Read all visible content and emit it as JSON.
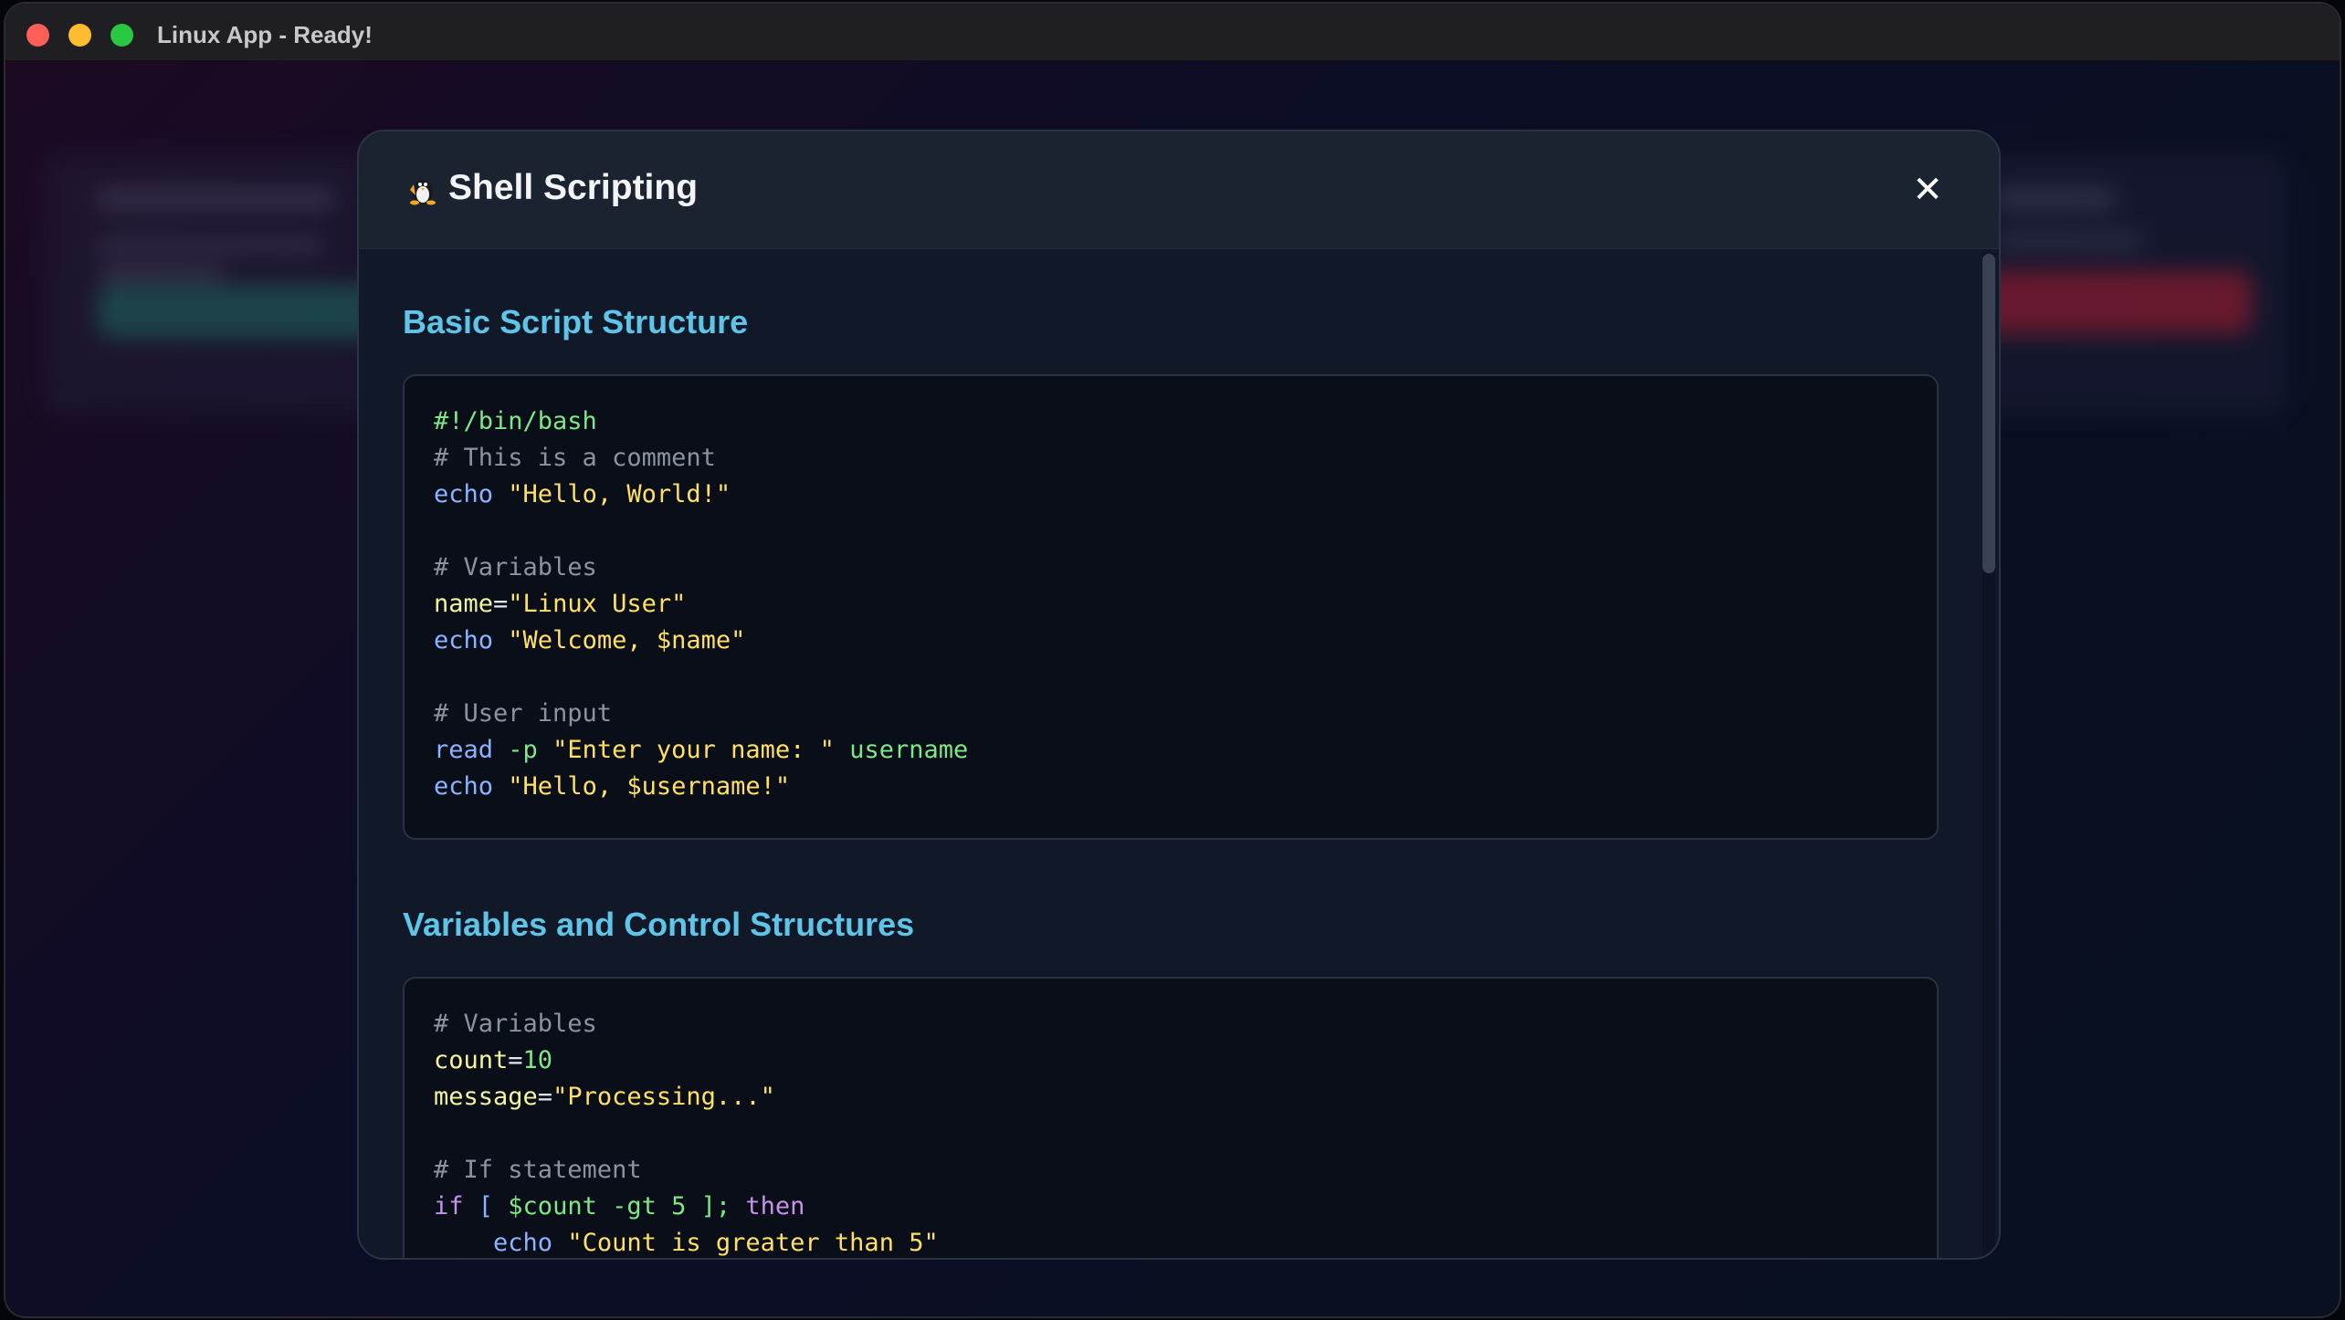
{
  "window": {
    "title": "Linux App - Ready!"
  },
  "modal": {
    "icon": "penguin-icon",
    "title": "Shell Scripting",
    "close_label": "✕"
  },
  "sections": [
    {
      "title": "Basic Script Structure",
      "code": [
        [
          {
            "t": "#!/bin/bash",
            "c": "shebang"
          }
        ],
        [
          {
            "t": "# This is a comment",
            "c": "comment"
          }
        ],
        [
          {
            "t": "echo",
            "c": "kw"
          },
          {
            "t": " ",
            "c": ""
          },
          {
            "t": "\"Hello, World!\"",
            "c": "str"
          }
        ],
        [],
        [
          {
            "t": "# Variables",
            "c": "comment"
          }
        ],
        [
          {
            "t": "name",
            "c": "var"
          },
          {
            "t": "=",
            "c": ""
          },
          {
            "t": "\"Linux User\"",
            "c": "str"
          }
        ],
        [
          {
            "t": "echo",
            "c": "kw"
          },
          {
            "t": " ",
            "c": ""
          },
          {
            "t": "\"Welcome, $name\"",
            "c": "str"
          }
        ],
        [],
        [
          {
            "t": "# User input",
            "c": "comment"
          }
        ],
        [
          {
            "t": "read",
            "c": "kw"
          },
          {
            "t": " ",
            "c": ""
          },
          {
            "t": "-p",
            "c": "green"
          },
          {
            "t": " ",
            "c": ""
          },
          {
            "t": "\"Enter your name: \"",
            "c": "str"
          },
          {
            "t": " ",
            "c": ""
          },
          {
            "t": "username",
            "c": "green"
          }
        ],
        [
          {
            "t": "echo",
            "c": "kw"
          },
          {
            "t": " ",
            "c": ""
          },
          {
            "t": "\"Hello, $username!\"",
            "c": "str"
          }
        ]
      ]
    },
    {
      "title": "Variables and Control Structures",
      "code": [
        [
          {
            "t": "# Variables",
            "c": "comment"
          }
        ],
        [
          {
            "t": "count",
            "c": "var"
          },
          {
            "t": "=",
            "c": ""
          },
          {
            "t": "10",
            "c": "green"
          }
        ],
        [
          {
            "t": "message",
            "c": "var"
          },
          {
            "t": "=",
            "c": ""
          },
          {
            "t": "\"Processing...\"",
            "c": "str"
          }
        ],
        [],
        [
          {
            "t": "# If statement",
            "c": "comment"
          }
        ],
        [
          {
            "t": "if",
            "c": "purple"
          },
          {
            "t": " [ ",
            "c": "kw"
          },
          {
            "t": "$count",
            "c": "green"
          },
          {
            "t": " -gt 5 ]; ",
            "c": "green"
          },
          {
            "t": "then",
            "c": "purple"
          }
        ],
        [
          {
            "t": "    ",
            "c": ""
          },
          {
            "t": "echo",
            "c": "kw"
          },
          {
            "t": " ",
            "c": ""
          },
          {
            "t": "\"Count is greater than 5\"",
            "c": "str"
          }
        ]
      ]
    }
  ]
}
